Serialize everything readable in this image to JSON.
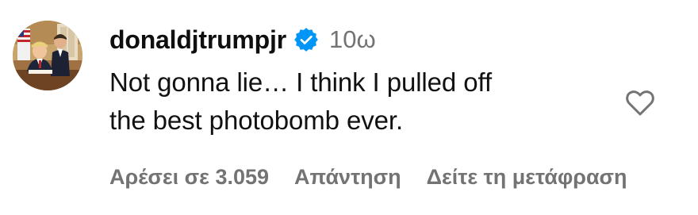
{
  "comment": {
    "username": "donaldjtrumpjr",
    "verified": true,
    "timestamp": "10ω",
    "text_lines": [
      "Not gonna lie… I think I pulled off",
      "the best photobomb ever."
    ],
    "likes_label": "Αρέσει σε 3.059",
    "reply_label": "Απάντηση",
    "translate_label": "Δείτε τη μετάφραση"
  },
  "icons": {
    "verified": "verified-badge-icon",
    "like": "heart-outline-icon"
  },
  "colors": {
    "verified_blue": "#0095f6",
    "secondary_text": "#737373",
    "primary_text": "#111111"
  }
}
